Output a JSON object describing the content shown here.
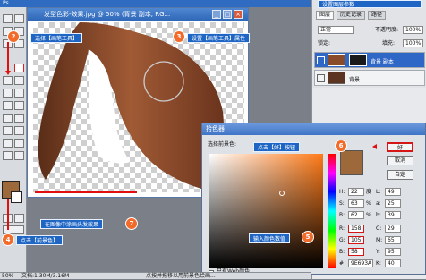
{
  "app": {
    "title_partial": "Ps"
  },
  "document": {
    "title": "发型色彩-效果.jpg @ 50% (背景 副本, RG..."
  },
  "callouts": {
    "step1": "选择【画笔工具】",
    "step2": "设置【画笔工具】属性",
    "step3": "点击【前景色】",
    "step4": "点击【好】按钮",
    "step5": "输入颜色数值",
    "step6": "在图像中涂画头发效果",
    "top_right": "设置图层参数"
  },
  "panel": {
    "tabs": [
      "图层",
      "历史记录",
      "路径"
    ],
    "mode": "正常",
    "opacity_label": "不透明度:",
    "opacity": "100%",
    "lock_label": "锁定:",
    "fill_label": "填充:",
    "fill": "100%",
    "layers": [
      {
        "name": "背景 副本"
      },
      {
        "name": "背景"
      }
    ]
  },
  "dialog": {
    "title": "拾色器",
    "subtitle": "选择前景色:",
    "ok": "好",
    "cancel": "取消",
    "custom": "自定",
    "web_only": "只有Web颜色",
    "labels": [
      "H:",
      "S:",
      "B:",
      "R:",
      "G:",
      "B:"
    ],
    "labels2": [
      "L:",
      "a:",
      "b:",
      "C:",
      "M:",
      "Y:",
      "K:"
    ],
    "values1": [
      "22",
      "63",
      "62",
      "158",
      "105",
      "58"
    ],
    "values2": [
      "49",
      "25",
      "39",
      "29",
      "65",
      "95",
      "40"
    ],
    "units": [
      "度",
      "%",
      "%",
      "",
      "",
      ""
    ],
    "hex": "9E693A"
  },
  "status": {
    "zoom": "50%",
    "doc": "文档:1.30M/3.16M",
    "hint": "点按并拖移以用前景色绘画..."
  }
}
